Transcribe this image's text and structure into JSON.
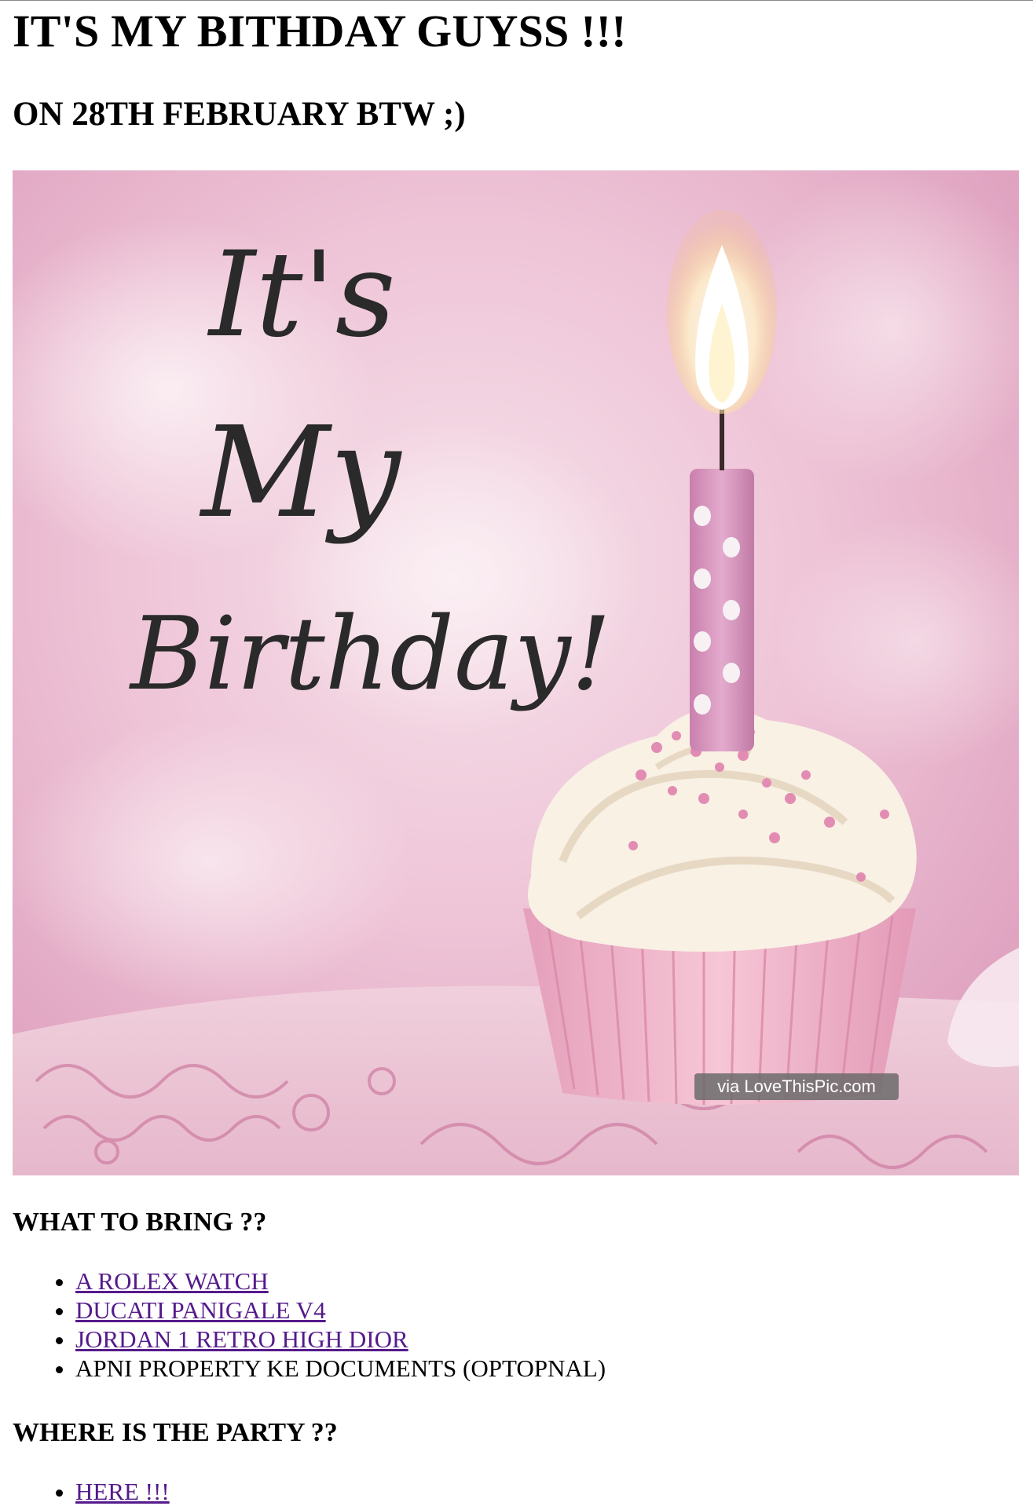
{
  "header": {
    "title": "IT'S MY BITHDAY GUYSS !!!",
    "subtitle": "ON 28TH FEBRUARY BTW ;)"
  },
  "hero_image": {
    "script_line1": "It's",
    "script_line2": "My",
    "script_line3": "Birthday!",
    "watermark": "via LoveThisPic.com",
    "colors": {
      "background": "#e9b7cf",
      "candle": "#d897c0",
      "frosting": "#f8f1e4",
      "liner": "#eeaec4"
    }
  },
  "bring": {
    "heading": "WHAT TO BRING ??",
    "items": [
      {
        "label": "A ROLEX WATCH",
        "link": true
      },
      {
        "label": "DUCATI PANIGALE V4",
        "link": true
      },
      {
        "label": "JORDAN 1 RETRO HIGH DIOR",
        "link": true
      },
      {
        "label": "APNI PROPERTY KE DOCUMENTS (OPTOPNAL)",
        "link": false
      }
    ]
  },
  "party": {
    "heading": "WHERE IS THE PARTY ??",
    "items": [
      {
        "label": "HERE !!!",
        "link": true
      }
    ]
  },
  "link_color": "#551a8b"
}
